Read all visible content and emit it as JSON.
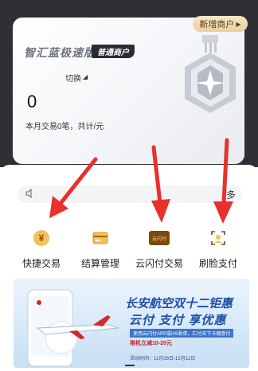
{
  "header": {
    "add_merchant_label": "新增商户",
    "add_merchant_arrow": "▶"
  },
  "card": {
    "title": "智汇蓝极速版",
    "badge": "普通商户",
    "switch_label": "切换",
    "switch_caret": "◢",
    "amount": "0",
    "summary": "本月交易0笔，共计/元"
  },
  "notice": {
    "more_label": "多"
  },
  "functions": [
    {
      "label": "快捷交易",
      "icon": "yen-coin-icon",
      "icon_text": "¥"
    },
    {
      "label": "结算管理",
      "icon": "card-icon"
    },
    {
      "label": "云闪付交易",
      "icon": "quickpass-icon",
      "icon_text": "云闪付"
    },
    {
      "label": "刷脸支付",
      "icon": "face-scan-icon"
    }
  ],
  "banner": {
    "title_line1": "长安航空双十二钜惠",
    "title_line2": "云付 支付 享优惠",
    "sub_line1": "使用云闪付APP或HS收单，汇付天下卡随意付",
    "sub_line2": "限机立减10-20元",
    "date_line": "活动时间：11月28日-12月12日"
  },
  "colors": {
    "accent_gold": "#e8cf9f",
    "dark_bg": "#2f2f35",
    "arrow_red": "#e8302c"
  }
}
